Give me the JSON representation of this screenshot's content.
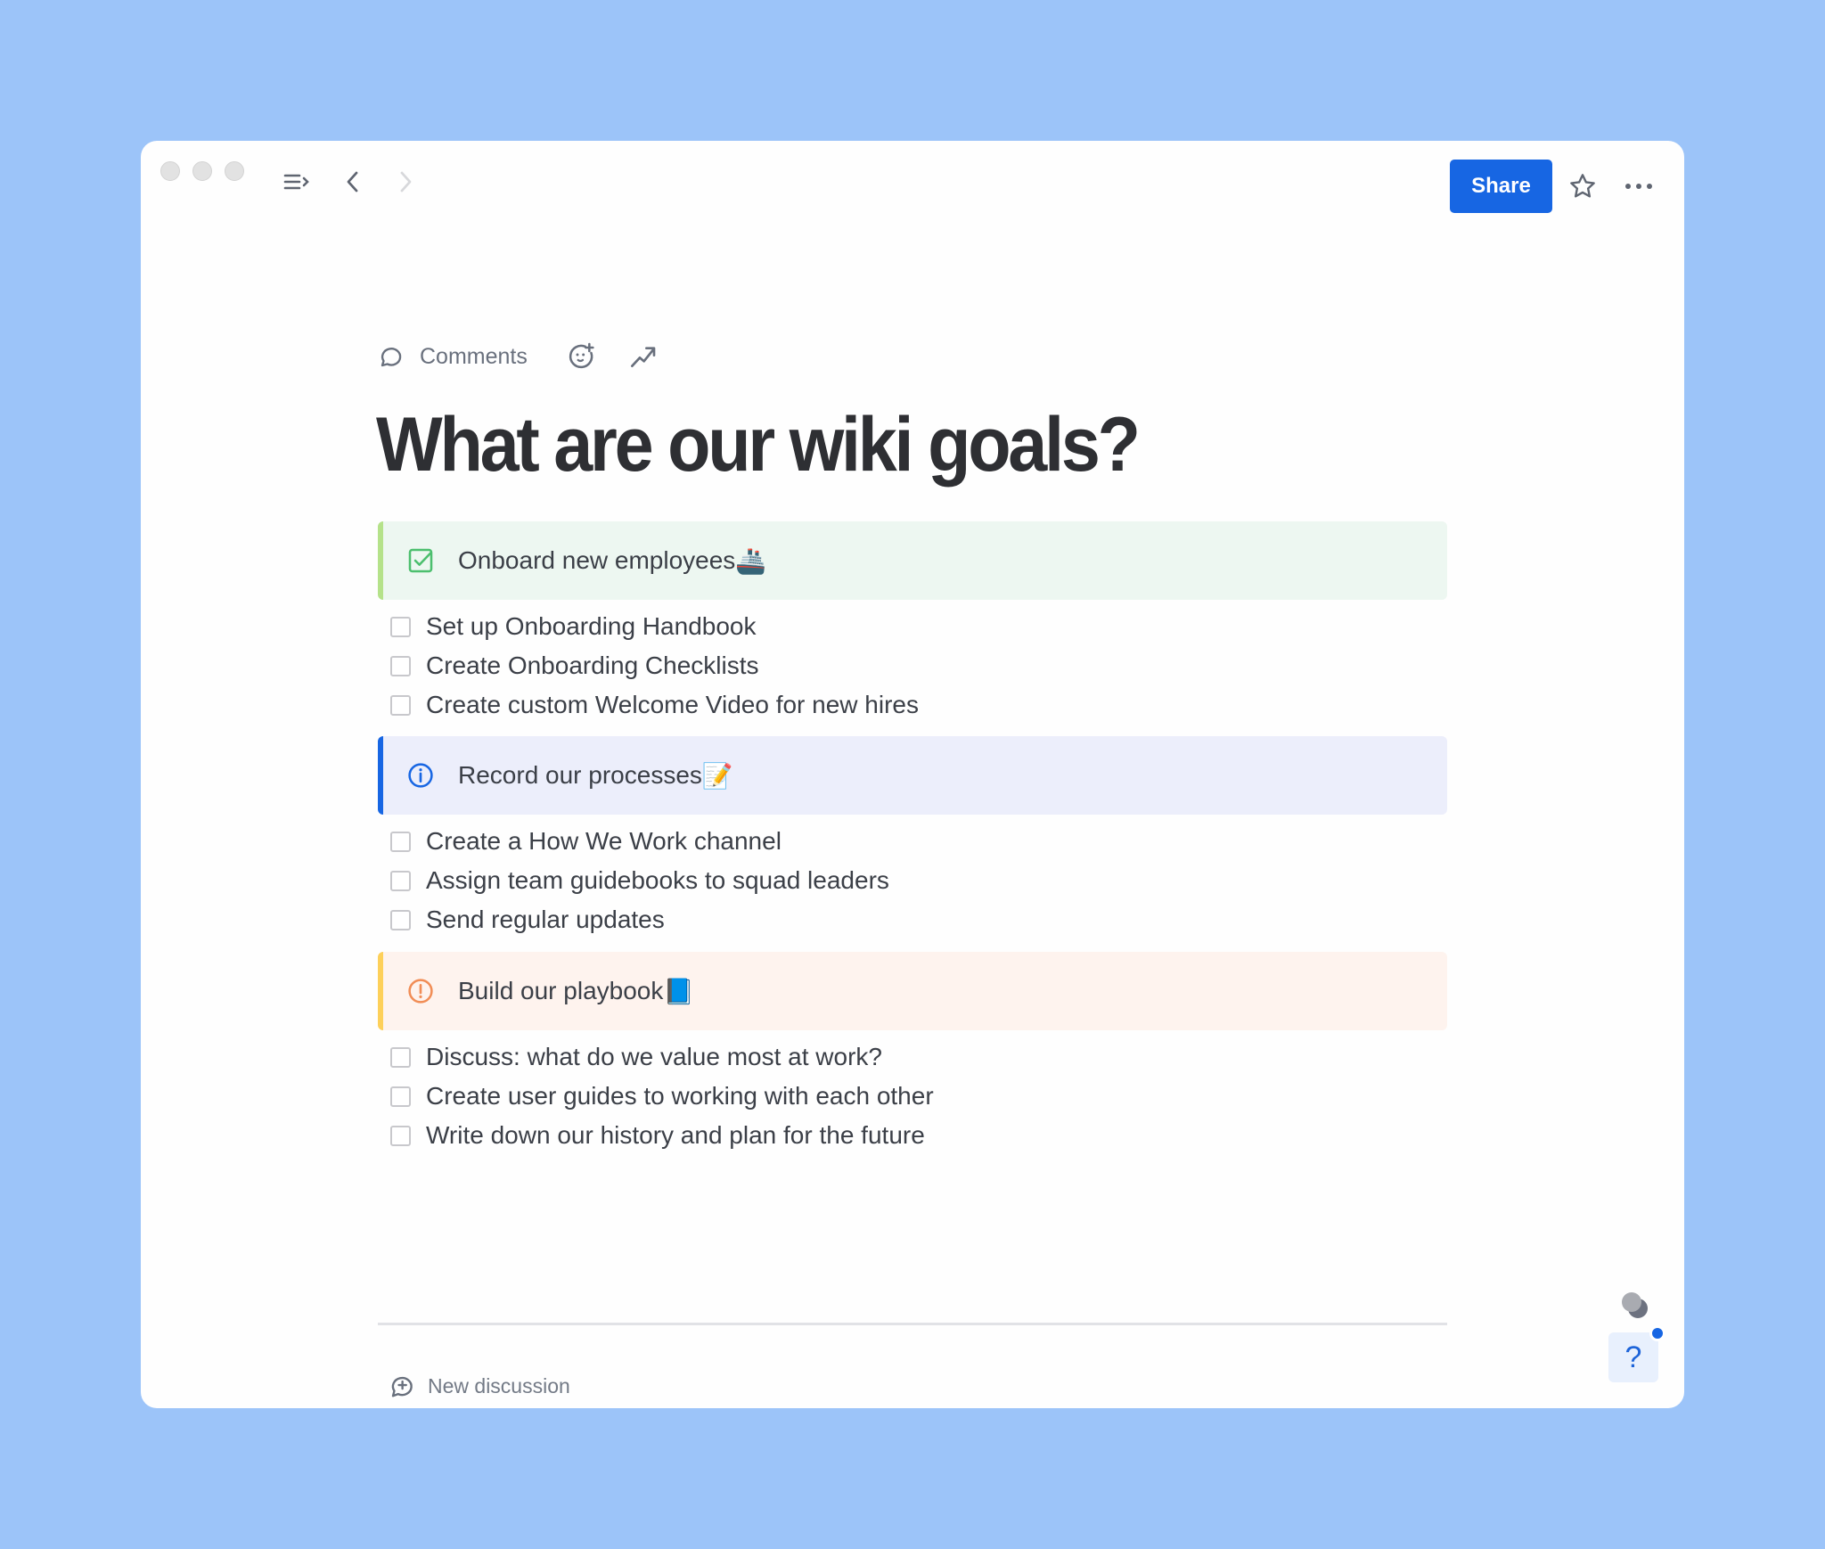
{
  "toolbar": {
    "share_label": "Share",
    "icons": {
      "sidebar_toggle": "sidebar-toggle-icon",
      "back": "chevron-left-icon",
      "forward": "chevron-right-icon",
      "star": "star-icon",
      "more": "more-horizontal-icon"
    }
  },
  "meta": {
    "comments_label": "Comments",
    "reaction_icon": "add-reaction-icon",
    "insights_icon": "trending-up-icon"
  },
  "page": {
    "title": "What are our wiki goals?"
  },
  "sections": [
    {
      "heading": "Onboard new employees",
      "emoji": "🚢",
      "icon": "checkbox-checked-icon",
      "accent": "#b5e28a",
      "background": "#edf7f1",
      "icon_color": "#4cbf6e",
      "tasks": [
        {
          "label": "Set up Onboarding Handbook",
          "checked": false
        },
        {
          "label": "Create Onboarding Checklists",
          "checked": false
        },
        {
          "label": "Create custom Welcome Video for new hires",
          "checked": false
        }
      ]
    },
    {
      "heading": "Record our processes",
      "emoji": "📝",
      "icon": "info-icon",
      "accent": "#1766e3",
      "background": "#eceefb",
      "icon_color": "#1766e3",
      "tasks": [
        {
          "label": "Create a How We Work channel",
          "checked": false
        },
        {
          "label": "Assign team guidebooks to squad leaders",
          "checked": false
        },
        {
          "label": "Send regular updates",
          "checked": false
        }
      ]
    },
    {
      "heading": "Build our playbook",
      "emoji": "📘",
      "icon": "alert-circle-icon",
      "accent": "#fdd05a",
      "background": "#fef3ee",
      "icon_color": "#f18d56",
      "tasks": [
        {
          "label": "Discuss: what do we value most at work?",
          "checked": false
        },
        {
          "label": "Create user guides to working with each other",
          "checked": false
        },
        {
          "label": "Write down our history and plan for the future",
          "checked": false
        }
      ]
    }
  ],
  "footer": {
    "new_discussion_label": "New discussion",
    "help_label": "?"
  },
  "colors": {
    "background": "#9cc4f9",
    "brand": "#1766e3"
  }
}
